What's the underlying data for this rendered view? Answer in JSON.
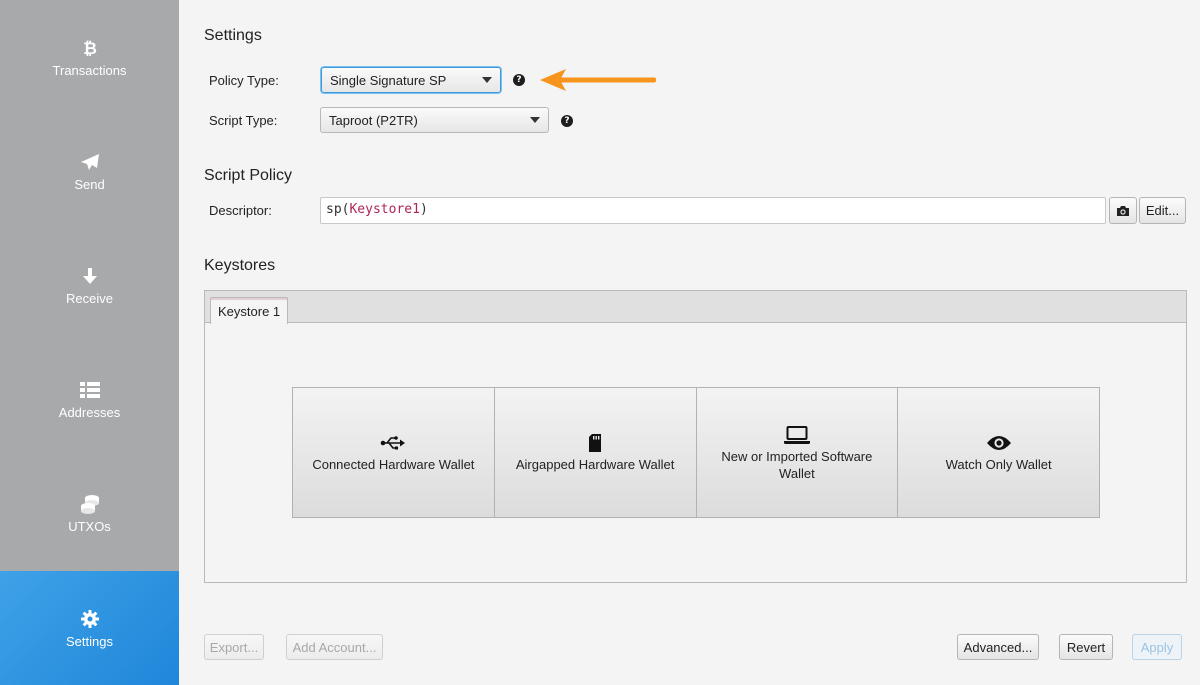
{
  "sidebar": {
    "items": [
      {
        "label": "Transactions",
        "icon": "bitcoin-icon",
        "active": false
      },
      {
        "label": "Send",
        "icon": "paper-plane-icon",
        "active": false
      },
      {
        "label": "Receive",
        "icon": "arrow-down-icon",
        "active": false
      },
      {
        "label": "Addresses",
        "icon": "list-icon",
        "active": false
      },
      {
        "label": "UTXOs",
        "icon": "coins-icon",
        "active": false
      },
      {
        "label": "Settings",
        "icon": "gear-icon",
        "active": true
      }
    ]
  },
  "settings": {
    "title": "Settings",
    "policy_type_label": "Policy Type:",
    "policy_type_value": "Single Signature SP",
    "script_type_label": "Script Type:",
    "script_type_value": "Taproot (P2TR)",
    "help_glyph": "?"
  },
  "script_policy": {
    "title": "Script Policy",
    "descriptor_label": "Descriptor:",
    "descriptor_fn": "sp(",
    "descriptor_arg": "Keystore1",
    "descriptor_close": ")",
    "edit_label": "Edit..."
  },
  "keystores": {
    "title": "Keystores",
    "tabs": [
      {
        "label": "Keystore 1"
      }
    ],
    "import_options": [
      {
        "label": "Connected Hardware Wallet",
        "icon": "usb-icon"
      },
      {
        "label": "Airgapped Hardware Wallet",
        "icon": "sd-card-icon"
      },
      {
        "label": "New or Imported Software Wallet",
        "icon": "laptop-icon"
      },
      {
        "label": "Watch Only Wallet",
        "icon": "eye-icon"
      }
    ]
  },
  "footer": {
    "export_label": "Export...",
    "add_account_label": "Add Account...",
    "advanced_label": "Advanced...",
    "revert_label": "Revert",
    "apply_label": "Apply"
  },
  "colors": {
    "sidebar_bg": "#a8a9ab",
    "active_nav": "#2b93e0",
    "annotation_arrow": "#f7941d",
    "descriptor_arg": "#b0245a"
  }
}
